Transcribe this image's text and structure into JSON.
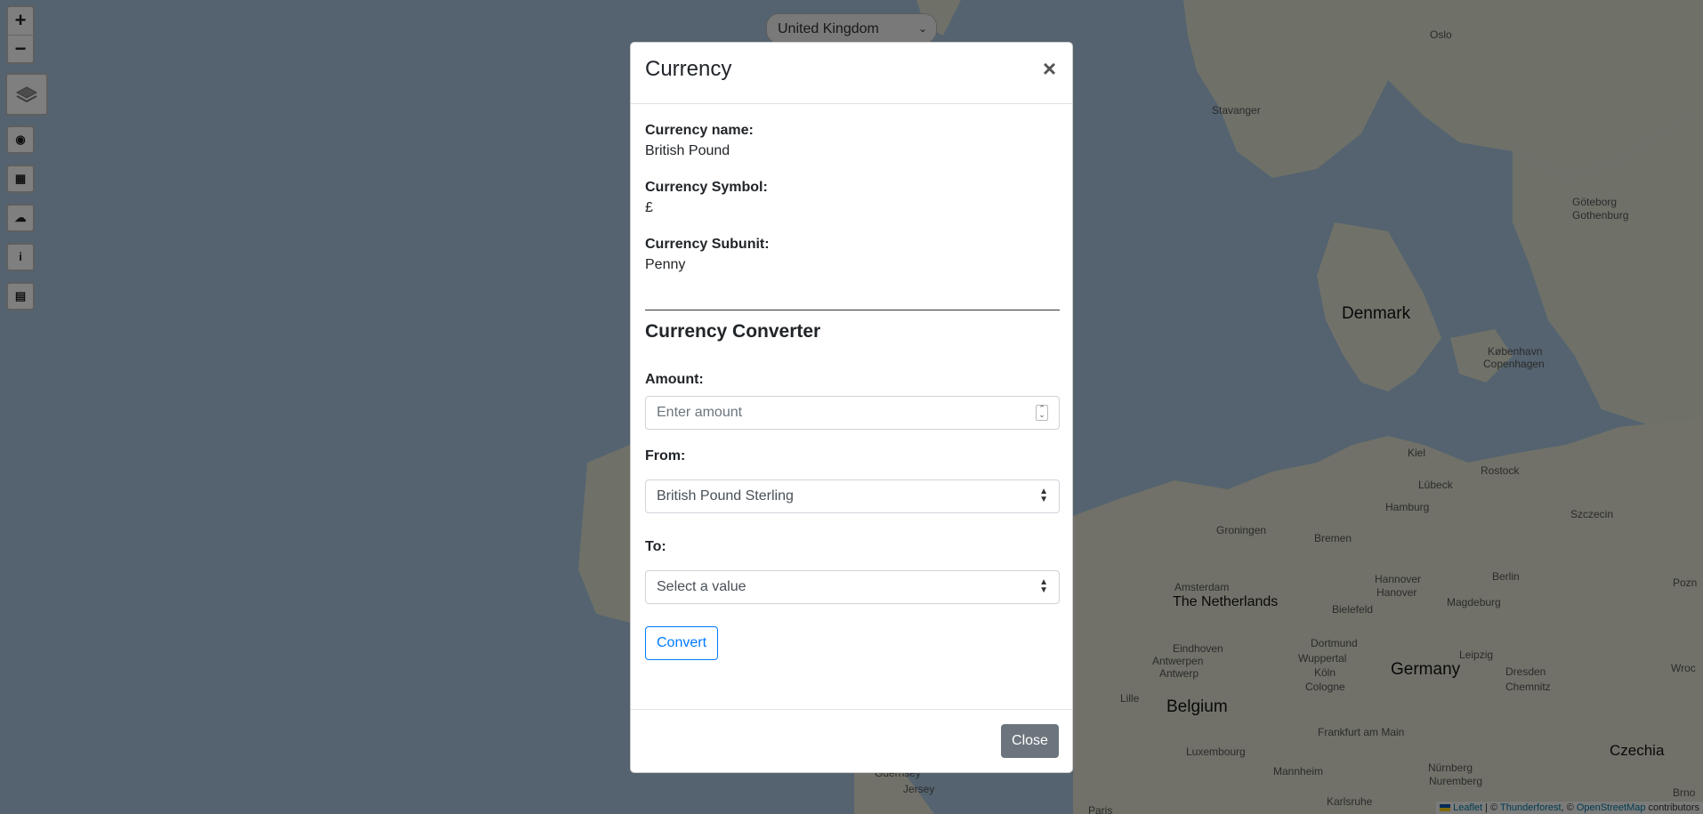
{
  "map": {
    "region_select": "United Kingdom",
    "countries": [
      "Denmark",
      "The Netherlands",
      "Belgium",
      "Germany",
      "Czechia"
    ],
    "cities": [
      "Oslo",
      "Stavanger",
      "Göteborg",
      "Gothenburg",
      "København",
      "Copenhagen",
      "Kiel",
      "Lübeck",
      "Rostock",
      "Hamburg",
      "Szczecin",
      "Groningen",
      "Bremen",
      "Amsterdam",
      "Hannover",
      "Hanover",
      "Berlin",
      "Bielefeld",
      "Magdeburg",
      "Dortmund",
      "Eindhoven",
      "Wuppertal",
      "Antwerpen",
      "Antwerp",
      "Köln",
      "Cologne",
      "Leipzig",
      "Dresden",
      "Chemnitz",
      "Lille",
      "Frankfurt am Main",
      "Luxembourg",
      "Mannheim",
      "Nürnberg",
      "Nuremberg",
      "Guernsey",
      "Jersey",
      "Paris",
      "Karlsruhe",
      "Brno",
      "Wroc",
      "Pozn"
    ]
  },
  "controls": {
    "zoom_in": "+",
    "zoom_out": "−",
    "easy_buttons": [
      "globe-icon",
      "money-icon",
      "weather-icon",
      "info-icon",
      "news-icon"
    ]
  },
  "modal": {
    "title": "Currency",
    "close_x": "×",
    "currency_name_label": "Currency name:",
    "currency_name": "British Pound",
    "currency_symbol_label": "Currency Symbol:",
    "currency_symbol": "£",
    "currency_subunit_label": "Currency Subunit:",
    "currency_subunit": "Penny",
    "converter_title": "Currency Converter",
    "amount_label": "Amount:",
    "amount_placeholder": "Enter amount",
    "from_label": "From:",
    "from_value": "British Pound Sterling",
    "to_label": "To:",
    "to_value": "Select a value",
    "convert_button": "Convert",
    "close_button": "Close"
  },
  "attribution": {
    "leaflet": "Leaflet",
    "sep1": " | © ",
    "thunderforest": "Thunderforest",
    "sep2": ", © ",
    "osm": "OpenStreetMap",
    "suffix": " contributors"
  }
}
